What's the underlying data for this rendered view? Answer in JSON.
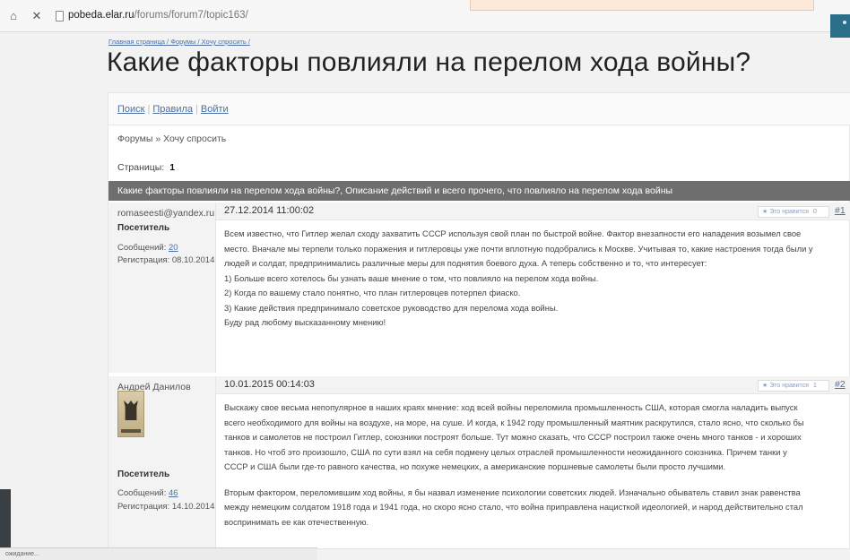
{
  "browser": {
    "url_prefix": "pobeda.elar.ru",
    "url_path": "/forums/forum7/topic163/"
  },
  "breadcrumb": "Главная страница / Форумы / Хочу спросить /",
  "page_title": "Какие факторы повлияли на перелом хода войны?",
  "topnav": {
    "search": "Поиск",
    "rules": "Правила",
    "login": "Войти"
  },
  "crumbs": "Форумы » Хочу спросить",
  "pages": {
    "label": "Страницы:",
    "current": "1"
  },
  "topic_bar": "Какие факторы повлияли на перелом хода войны?, Описание действий и всего прочего, что повлияло на перелом хода войны",
  "posts": [
    {
      "author": "romaseesti@yandex.ru",
      "role": "Посетитель",
      "messages_label": "Сообщений:",
      "messages": "20",
      "registration": "Регистрация: 08.10.2014",
      "date": "27.12.2014 11:00:02",
      "like_label": "Это нравится",
      "like_count": "0",
      "number": "#1",
      "body": [
        "Всем известно, что Гитлер желал сходу захватить СССР используя свой план по быстрой войне. Фактор внезапности его нападения возымел свое",
        "место. Вначале мы терпели только поражения и гитлеровцы уже почти вплотную подобрались к Москве. Учитывая то, какие настроения тогда были у",
        "людей и солдат, предпринимались различные меры для поднятия боевого духа. А теперь собственно и то, что интересует:",
        "1) Больше всего хотелось бы узнать ваше мнение о том, что повлияло на перелом хода войны.",
        "2) Когда по вашему стало понятно, что план гитлеровцев потерпел фиаско.",
        "3) Какие действия предпринимало советское руководство для перелома хода войны.",
        "Буду рад любому высказанному мнению!"
      ]
    },
    {
      "author": "Андрей Данилов",
      "role": "Посетитель",
      "messages_label": "Сообщений:",
      "messages": "46",
      "registration": "Регистрация: 14.10.2014",
      "date": "10.01.2015 00:14:03",
      "like_label": "Это нравится",
      "like_count": "1",
      "number": "#2",
      "body": [
        "Выскажу свое весьма непопулярное в наших краях мнение: ход всей войны переломила промышленность США, которая смогла наладить выпуск",
        "всего необходимого для войны на воздухе, на море, на суше. И когда, к 1942 году промышленный маятник раскрутился, стало ясно, что сколько бы",
        "танков и самолетов не построил Гитлер, союзники построят больше. Тут можно сказать, что СССР построил также очень много танков - и хороших",
        "танков. Но чтоб это произошло, США по сути взял на себя подмену целых отраслей промышленности неожиданного союзника. Причем танки у",
        "СССР и США были где-то равного качества, но похуже немецких, а американские поршневые самолеты были просто лучшими.",
        "Вторым фактором, переломившим ход войны, я бы назвал изменение психологии советских людей. Изначально обыватель ставил знак равенства",
        "между немецким солдатом 1918 года и 1941 года, но скоро ясно стало, что война приправлена нацисткой идеологией, и народ действительно стал",
        "воспринимать ее как отечественную."
      ]
    }
  ],
  "status_text": "ожидание..."
}
